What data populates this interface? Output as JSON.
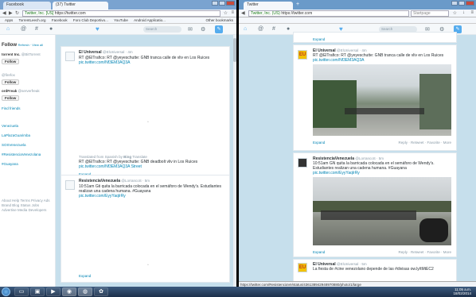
{
  "left_window": {
    "tabs": [
      {
        "label": "Facebook"
      },
      {
        "label": "(37) Twitter"
      }
    ],
    "url_secure": "Twitter, Inc. [US]",
    "url": "https://twitter.com",
    "bookmarks": [
      "Apps",
      "TorrentLeech.org",
      "Facebook",
      "Foro Club Deportivo...",
      "YouTube",
      "Android Applicatio...",
      "Other bookmarks"
    ],
    "search_placeholder": "Search",
    "sidebar": {
      "follow_label": "Follow",
      "refresh": "Refresh · View all",
      "users": [
        {
          "name": "torrent Inc.",
          "handle": "@BitTorrent"
        },
        {
          "name": "",
          "handle": "@firefox"
        },
        {
          "name": "ordFreak",
          "handle": "@serverfreak"
        }
      ],
      "find_friends": "Find friends",
      "tags": [
        "Venezuela",
        "LaPlazaGuarimba",
        "SOSVenezuela",
        "#ResistenciaVenezolana",
        "#Guayana"
      ],
      "footer": [
        "About",
        "Help",
        "Terms",
        "Privacy",
        "Ads",
        "Brand",
        "Blog",
        "Status",
        "Jobs",
        "Advertise",
        "Media",
        "Developers"
      ]
    },
    "tweets": [
      {
        "name": "El Universal",
        "handle": "@ElUniversal · 4m",
        "text": "RT @ElTrafico: RT @yeyeschutte: GNB tranca calle de vliv en Los Ruices",
        "link": "pic.twitter.com/Nf3EM3AQ3A",
        "translated_from": "Translated from Spanish by",
        "translator": "Bing",
        "translator_suffix": "Translate",
        "translation": "RT @ElTrafico: RT @yeyeschutte: GNB deadbolt vliv in Los Ruices",
        "translation_link": "pic.twitter.com/Nf3EM3AQ3A Street",
        "expand": "Expand"
      },
      {
        "name": "ResistenciaVenezuela",
        "handle": "@LorrancoS · 5m",
        "text": "10:51am Gti quita la barricada colocada en el semáforo de Wendy's. Estudiantes realizan una cadena humana. #Guayana",
        "link": "pic.twitter.com/EyyYaqlrRy",
        "expand": "Expand"
      }
    ]
  },
  "right_window": {
    "title": "Twitter",
    "url_secure": "Twitter, Inc. (US)",
    "url": "https://twitter.com",
    "search_label": "Startpage",
    "search_placeholder": "Search",
    "tweets": [
      {
        "name": "El Universal",
        "handle": "@ElUniversal · 4m",
        "text": "RT @ElTrafico: RT @yeyeschutte: GNB tranca calle de vliv en Los Ruices",
        "link": "pic.twitter.com/Nf3EM3AQ3A",
        "expand": "Expand",
        "actions": "Reply · Retweet · Favorite · More"
      },
      {
        "name": "ResistenciaVenezuela",
        "handle": "@LorrancoS · 5m",
        "text": "10:51am GN quita la barricada colocada en el semáforo de Wendy's. Estudiantes realizan una cadena humana. #Guayana",
        "link": "pic.twitter.com/EyyYaqlrRy",
        "expand": "Expand",
        "actions": "Reply · Retweet · Favorite · More"
      },
      {
        "name": "El Universal",
        "handle": "@ElUniversal · 5m",
        "text": "La fiesta de #cine venezolano depende de las #divisas ow.ly/tMtEC2"
      }
    ],
    "statusbar": "https://twitter.com/ResistenciaVe/status/436138942948970880/photo/1/large"
  },
  "taskbar": {
    "time": "11:05 a.m.",
    "date": "18/02/2014"
  },
  "colors": {
    "accent": "#55acee",
    "link": "#0084b4",
    "timeline_bg": "#c6dfec"
  }
}
